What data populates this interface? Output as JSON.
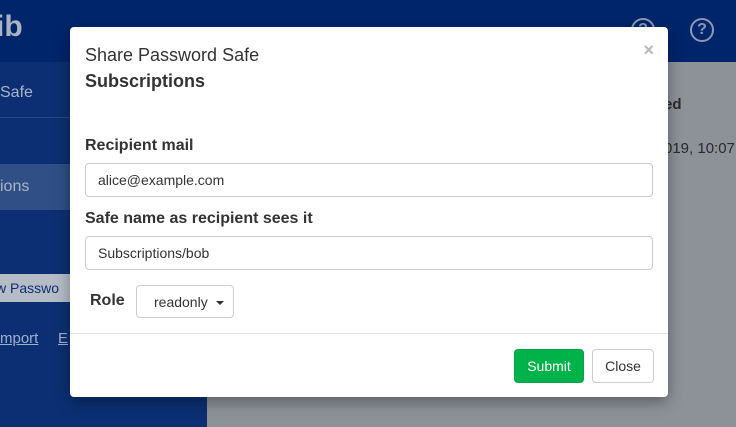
{
  "app": {
    "title": "ib",
    "sidebar": {
      "items": [
        {
          "label": "Safe"
        },
        {
          "label": "ions"
        }
      ],
      "new_password_label": "w Passwo",
      "import_link": "mport",
      "export_link": "E"
    },
    "table": {
      "column_header": "ed",
      "cell": "019, 10:07"
    }
  },
  "modal": {
    "title": "Share Password Safe",
    "subtitle": "Subscriptions",
    "close_symbol": "×",
    "recipient": {
      "label": "Recipient mail",
      "value": "alice@example.com"
    },
    "safe_name": {
      "label": "Safe name as recipient sees it",
      "value": "Subscriptions/bob"
    },
    "role": {
      "label": "Role",
      "selected": "readonly"
    },
    "buttons": {
      "submit": "Submit",
      "close": "Close"
    }
  }
}
